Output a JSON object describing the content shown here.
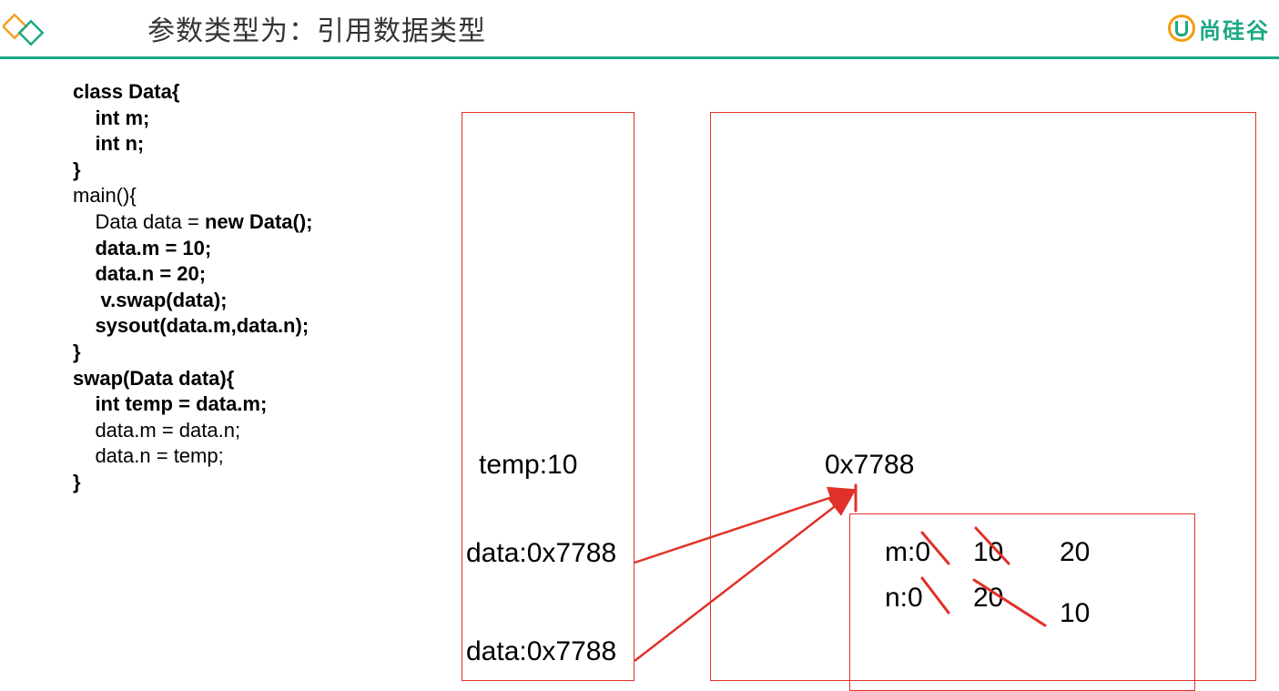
{
  "header": {
    "title": "参数类型为：引用数据类型",
    "right_logo_text": "尚硅谷"
  },
  "code": {
    "l1": "class Data{",
    "l2": "    int m;",
    "l3": "    int n;",
    "l4": "}",
    "l5": "",
    "l6": "",
    "l7": "main(){",
    "l8_a": "    Data data = ",
    "l8_b": "new Data();",
    "l9": "    data.m = 10;",
    "l10": "    data.n = 20;",
    "l11": "     v.swap(data);",
    "l12": "    sysout(data.m,data.n);",
    "l13": "}",
    "l14": "swap(Data data){",
    "l15": "    int temp = data.m;",
    "l16": "    data.m = data.n;",
    "l17": "    data.n = temp;",
    "l18": "}"
  },
  "stack": {
    "temp": "temp:10",
    "data1": "data:0x7788",
    "data2": "data:0x7788"
  },
  "heap": {
    "address": "0x7788",
    "m_label": "m:0",
    "m_v1": "10",
    "m_v2": "20",
    "n_label": "n:0",
    "n_v1": "20",
    "n_v2": "10"
  }
}
